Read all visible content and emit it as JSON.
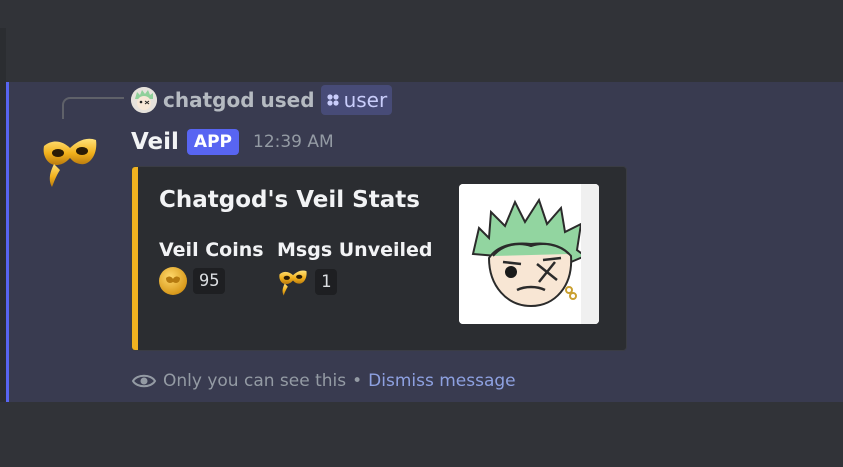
{
  "reply": {
    "user": "chatgod",
    "action": "used",
    "command": "user"
  },
  "message": {
    "author": "Veil",
    "badge": "APP",
    "timestamp": "12:39 AM"
  },
  "embed": {
    "title": "Chatgod's Veil Stats",
    "accent_color": "#f0b220",
    "fields": [
      {
        "name": "Veil Coins",
        "value": "95",
        "icon": "coin-icon"
      },
      {
        "name": "Msgs Unveiled",
        "value": "1",
        "icon": "mask-icon"
      }
    ],
    "thumbnail": "anime-avatar"
  },
  "footer": {
    "notice": "Only you can see this",
    "separator": "•",
    "dismiss": "Dismiss message"
  },
  "colors": {
    "background": "#313338",
    "highlight": "#393b50",
    "brand": "#5865f2",
    "link": "#8ea1e1"
  }
}
